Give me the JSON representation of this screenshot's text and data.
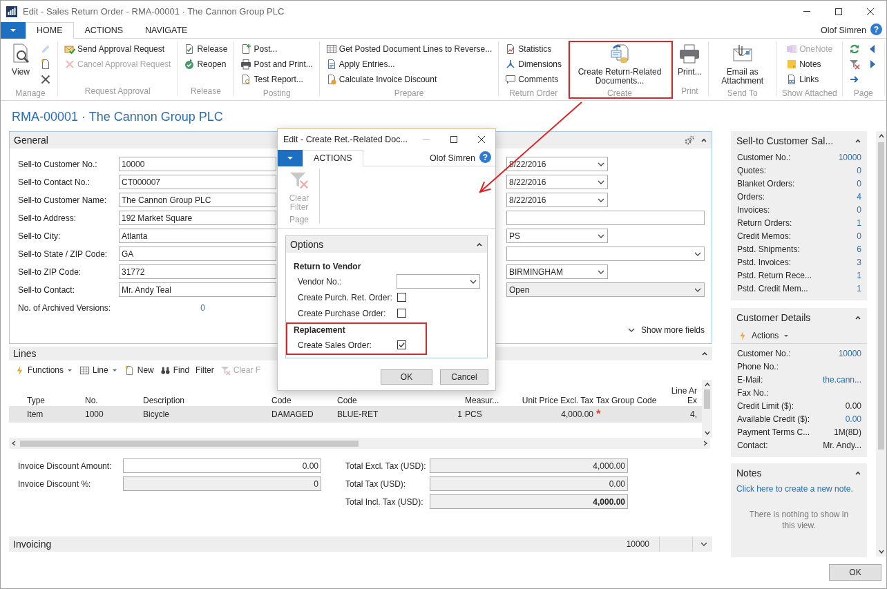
{
  "window": {
    "title": "Edit - Sales Return Order - RMA-00001 · The Cannon Group PLC"
  },
  "ribbon": {
    "tabs": [
      {
        "label": "HOME",
        "selected": true
      },
      {
        "label": "ACTIONS",
        "selected": false
      },
      {
        "label": "NAVIGATE",
        "selected": false
      }
    ],
    "user": "Olof Simren",
    "help": "?",
    "groups": [
      {
        "label": "Manage",
        "highlighted": false,
        "items": [
          {
            "kind": "big",
            "label": "View",
            "disabled": false
          },
          {
            "kind": "icon",
            "disabled": true
          },
          {
            "kind": "icon",
            "disabled": false
          },
          {
            "kind": "icon",
            "disabled": false
          }
        ]
      },
      {
        "label": "Request Approval",
        "highlighted": false,
        "items": [
          {
            "kind": "small",
            "label": "Send Approval Request",
            "disabled": false
          },
          {
            "kind": "small",
            "label": "Cancel Approval Request",
            "disabled": true
          }
        ]
      },
      {
        "label": "Release",
        "highlighted": false,
        "items": [
          {
            "kind": "small",
            "label": "Release",
            "disabled": false
          },
          {
            "kind": "small",
            "label": "Reopen",
            "disabled": false
          }
        ]
      },
      {
        "label": "Posting",
        "highlighted": false,
        "items": [
          {
            "kind": "small",
            "label": "Post...",
            "disabled": false
          },
          {
            "kind": "small",
            "label": "Post and Print...",
            "disabled": false
          },
          {
            "kind": "small",
            "label": "Test Report...",
            "disabled": false
          }
        ]
      },
      {
        "label": "Prepare",
        "highlighted": false,
        "items": [
          {
            "kind": "small",
            "label": "Get Posted Document Lines to Reverse...",
            "disabled": false
          },
          {
            "kind": "small",
            "label": "Apply Entries...",
            "disabled": false
          },
          {
            "kind": "small",
            "label": "Calculate Invoice Discount",
            "disabled": false
          }
        ]
      },
      {
        "label": "Return Order",
        "highlighted": false,
        "items": [
          {
            "kind": "small",
            "label": "Statistics",
            "disabled": false
          },
          {
            "kind": "small",
            "label": "Dimensions",
            "disabled": false
          },
          {
            "kind": "small",
            "label": "Comments",
            "disabled": false
          }
        ]
      },
      {
        "label": "Create",
        "highlighted": true,
        "items": [
          {
            "kind": "big",
            "label": "Create Return-Related Documents...",
            "disabled": false
          }
        ]
      },
      {
        "label": "Print",
        "highlighted": false,
        "items": [
          {
            "kind": "big",
            "label": "Print...",
            "disabled": false
          }
        ]
      },
      {
        "label": "Send To",
        "highlighted": false,
        "items": [
          {
            "kind": "big",
            "label": "Email as Attachment",
            "disabled": false
          }
        ]
      },
      {
        "label": "Show Attached",
        "highlighted": false,
        "items": [
          {
            "kind": "small",
            "label": "OneNote",
            "disabled": true
          },
          {
            "kind": "small",
            "label": "Notes",
            "disabled": false
          },
          {
            "kind": "small",
            "label": "Links",
            "disabled": false
          }
        ]
      },
      {
        "label": "Page",
        "highlighted": false,
        "items": [
          {
            "kind": "icon",
            "disabled": false
          },
          {
            "kind": "icon",
            "disabled": false
          },
          {
            "kind": "icon",
            "disabled": false
          },
          {
            "kind": "icon",
            "disabled": false
          },
          {
            "kind": "icon",
            "disabled": false
          }
        ]
      }
    ]
  },
  "page_title": "RMA-00001 · The Cannon Group PLC",
  "general": {
    "title": "General",
    "show_more": "Show more fields",
    "left_fields": [
      {
        "label": "Sell-to Customer No.:",
        "value": "10000",
        "kind": "text"
      },
      {
        "label": "Sell-to Contact No.:",
        "value": "CT000007",
        "kind": "text"
      },
      {
        "label": "Sell-to Customer Name:",
        "value": "The Cannon Group PLC",
        "kind": "text"
      },
      {
        "label": "Sell-to Address:",
        "value": "192 Market Square",
        "kind": "text"
      },
      {
        "label": "Sell-to City:",
        "value": "Atlanta",
        "kind": "text"
      },
      {
        "label": "Sell-to State / ZIP Code:",
        "value": "GA",
        "kind": "text"
      },
      {
        "label": "Sell-to ZIP Code:",
        "value": "31772",
        "kind": "text"
      },
      {
        "label": "Sell-to Contact:",
        "value": "Mr. Andy Teal",
        "kind": "text"
      },
      {
        "label": "No. of Archived Versions:",
        "value": "0",
        "kind": "link"
      }
    ],
    "right_fields": [
      {
        "value": "8/22/2016",
        "kind": "select"
      },
      {
        "value": "8/22/2016",
        "kind": "select"
      },
      {
        "value": "8/22/2016",
        "kind": "select"
      },
      {
        "kind": "text-wide"
      },
      {
        "value": "PS",
        "kind": "select"
      },
      {
        "kind": "select-wide"
      },
      {
        "value": "BIRMINGHAM",
        "kind": "select"
      },
      {
        "value": "Open",
        "kind": "select-locked"
      }
    ]
  },
  "lines": {
    "title": "Lines",
    "actions": [
      {
        "label": "Functions",
        "menu": true,
        "disabled": false
      },
      {
        "label": "Line",
        "menu": true,
        "disabled": false
      },
      {
        "label": "New",
        "menu": false,
        "disabled": false
      },
      {
        "label": "Find",
        "menu": false,
        "disabled": false
      },
      {
        "label": "Filter",
        "menu": false,
        "disabled": false
      },
      {
        "label": "Clear F",
        "menu": false,
        "disabled": true
      }
    ],
    "columns": [
      {
        "label": "Type"
      },
      {
        "label": "No."
      },
      {
        "label": "Description"
      },
      {
        "label": "Code"
      },
      {
        "label": "Code"
      },
      {},
      {
        "label": "Measur..."
      },
      {
        "label": "Unit Price Excl. Tax"
      },
      {
        "label": "Tax Group Code"
      },
      {
        "label": "Line Ar Ex"
      }
    ],
    "rows": [
      {
        "selected": true,
        "cells": [
          "Item",
          "1000",
          "Bicycle",
          "DAMAGED",
          "BLUE-RET",
          "1",
          "PCS",
          "4,000.00",
          "*",
          "4,"
        ]
      }
    ]
  },
  "totals": {
    "left": [
      {
        "label": "Invoice Discount Amount:",
        "value": "0.00",
        "editable": true,
        "emphasis": false
      },
      {
        "label": "Invoice Discount %:",
        "value": "0",
        "editable": false,
        "emphasis": false
      }
    ],
    "right": [
      {
        "label": "Total Excl. Tax (USD):",
        "value": "4,000.00",
        "editable": false,
        "emphasis": false
      },
      {
        "label": "Total Tax (USD):",
        "value": "0.00",
        "editable": false,
        "emphasis": false
      },
      {
        "label": "Total Incl. Tax (USD):",
        "value": "4,000.00",
        "editable": false,
        "emphasis": true
      }
    ]
  },
  "invoicing": {
    "title": "Invoicing",
    "value": "10000"
  },
  "factboxes": [
    {
      "kind": "stats",
      "title": "Sell-to Customer Sal...",
      "rows": [
        {
          "label": "Customer No.:",
          "value": "10000",
          "link": true
        },
        {
          "label": "Quotes:",
          "value": "0",
          "link": true
        },
        {
          "label": "Blanket Orders:",
          "value": "0",
          "link": true
        },
        {
          "label": "Orders:",
          "value": "4",
          "link": true
        },
        {
          "label": "Invoices:",
          "value": "0",
          "link": true
        },
        {
          "label": "Return Orders:",
          "value": "1",
          "link": true
        },
        {
          "label": "Credit Memos:",
          "value": "0",
          "link": true
        },
        {
          "label": "Pstd. Shipments:",
          "value": "6",
          "link": true
        },
        {
          "label": "Pstd. Invoices:",
          "value": "3",
          "link": true
        },
        {
          "label": "Pstd. Return Rece...",
          "value": "1",
          "link": true
        },
        {
          "label": "Pstd. Credit Mem...",
          "value": "1",
          "link": true
        }
      ]
    },
    {
      "kind": "details",
      "title": "Customer Details",
      "actions": "Actions",
      "rows": [
        {
          "label": "Customer No.:",
          "value": "10000",
          "link": true
        },
        {
          "label": "Phone No.:"
        },
        {
          "label": "E-Mail:",
          "value": "the.cann...",
          "link": true
        },
        {
          "label": "Fax No.:"
        },
        {
          "label": "Credit Limit ($):",
          "value": "0.00",
          "link": false
        },
        {
          "label": "Available Credit ($):",
          "value": "0.00",
          "link": true
        },
        {
          "label": "Payment Terms C...",
          "value": "1M(8D)",
          "link": false
        },
        {
          "label": "Contact:",
          "value": "Mr. Andy...",
          "link": false
        }
      ]
    },
    {
      "kind": "notes",
      "title": "Notes",
      "link": "Click here to create a new note.",
      "empty": "There is nothing to show in this view."
    }
  ],
  "ok_button": "OK",
  "dialog": {
    "title": "Edit - Create Ret.-Related Doc...",
    "tabs": [
      {
        "label": "ACTIONS",
        "selected": true
      }
    ],
    "user": "Olof Simren",
    "help": "?",
    "ribbon": {
      "group": "Page",
      "items": [
        {
          "label": "Clear Filter",
          "disabled": true
        }
      ]
    },
    "options": {
      "title": "Options",
      "sections": [
        {
          "heading": "Return to Vendor",
          "highlighted": false,
          "fields": [
            {
              "label": "Vendor No.:",
              "kind": "select"
            },
            {
              "label": "Create Purch. Ret. Order:",
              "kind": "checkbox",
              "checked": false
            },
            {
              "label": "Create Purchase Order:",
              "kind": "checkbox",
              "checked": false
            }
          ]
        },
        {
          "heading": "Replacement",
          "highlighted": true,
          "fields": [
            {
              "label": "Create Sales Order:",
              "kind": "checkbox",
              "checked": true
            }
          ]
        }
      ]
    },
    "buttons": [
      "OK",
      "Cancel"
    ]
  }
}
